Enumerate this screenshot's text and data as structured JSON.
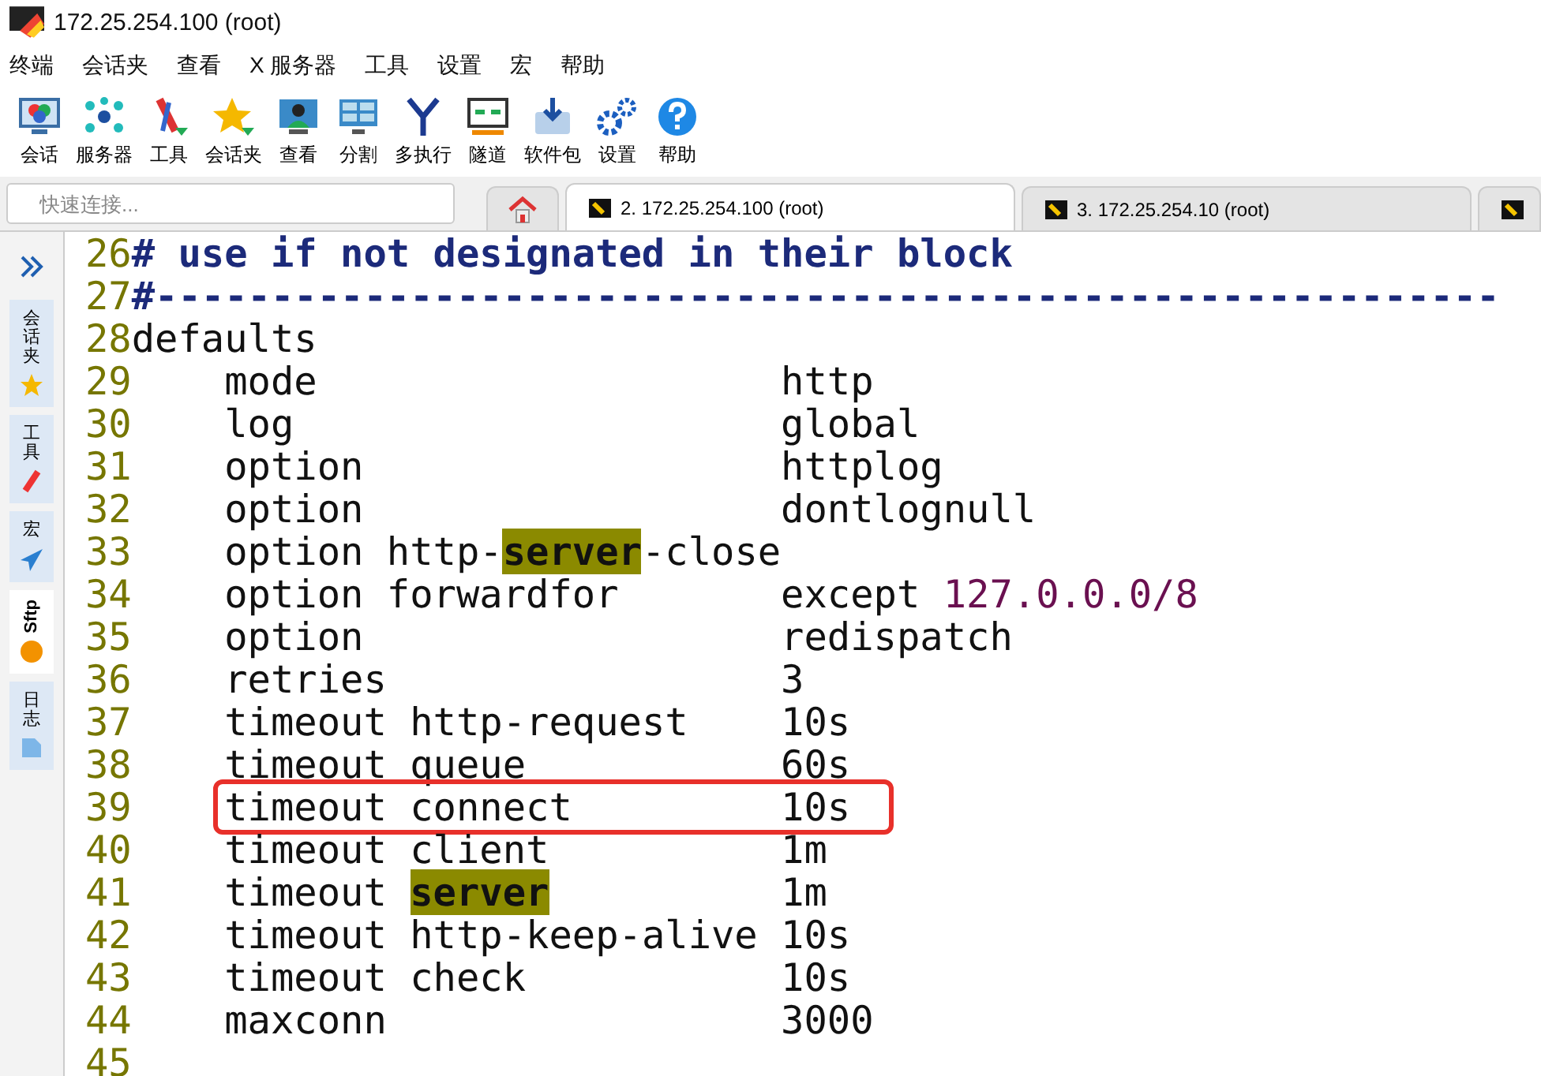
{
  "window": {
    "title": "172.25.254.100 (root)"
  },
  "menu": [
    "终端",
    "会话夹",
    "查看",
    "X 服务器",
    "工具",
    "设置",
    "宏",
    "帮助"
  ],
  "toolbar": [
    {
      "label": "会话"
    },
    {
      "label": "服务器"
    },
    {
      "label": "工具"
    },
    {
      "label": "会话夹"
    },
    {
      "label": "查看"
    },
    {
      "label": "分割"
    },
    {
      "label": "多执行"
    },
    {
      "label": "隧道"
    },
    {
      "label": "软件包"
    },
    {
      "label": "设置"
    },
    {
      "label": "帮助"
    }
  ],
  "quick_connect": {
    "placeholder": "快速连接..."
  },
  "tabs": [
    {
      "kind": "home",
      "selected": false
    },
    {
      "kind": "session",
      "label": "2. 172.25.254.100 (root)",
      "selected": true
    },
    {
      "kind": "session",
      "label": "3. 172.25.254.10 (root)",
      "selected": false
    },
    {
      "kind": "session",
      "selected": false
    }
  ],
  "sidebar": {
    "items": [
      {
        "label": "会话夹",
        "selected": false
      },
      {
        "label": "工具",
        "selected": false
      },
      {
        "label": "宏",
        "selected": false
      },
      {
        "label": "Sftp",
        "selected": true
      },
      {
        "label": "日志",
        "selected": false
      }
    ]
  },
  "editor": {
    "lines": [
      {
        "number": "26",
        "boxed": false,
        "segments": [
          {
            "kind": "comment",
            "text": "# use if not designated in their block"
          }
        ]
      },
      {
        "number": "27",
        "boxed": false,
        "segments": [
          {
            "kind": "comment",
            "text": "#----------------------------------------------------------"
          }
        ]
      },
      {
        "number": "28",
        "boxed": false,
        "segments": [
          {
            "kind": "plain",
            "text": "defaults"
          }
        ]
      },
      {
        "number": "29",
        "boxed": false,
        "segments": [
          {
            "kind": "plain",
            "text": "    mode                    http"
          }
        ]
      },
      {
        "number": "30",
        "boxed": false,
        "segments": [
          {
            "kind": "plain",
            "text": "    log                     global"
          }
        ]
      },
      {
        "number": "31",
        "boxed": false,
        "segments": [
          {
            "kind": "plain",
            "text": "    option                  httplog"
          }
        ]
      },
      {
        "number": "32",
        "boxed": false,
        "segments": [
          {
            "kind": "plain",
            "text": "    option                  dontlognull"
          }
        ]
      },
      {
        "number": "33",
        "boxed": false,
        "segments": [
          {
            "kind": "plain",
            "text": "    option http-"
          },
          {
            "kind": "highlight",
            "text": "server"
          },
          {
            "kind": "plain",
            "text": "-close"
          }
        ]
      },
      {
        "number": "34",
        "boxed": false,
        "segments": [
          {
            "kind": "plain",
            "text": "    option forwardfor       except "
          },
          {
            "kind": "number",
            "text": "127.0.0.0/8"
          }
        ]
      },
      {
        "number": "35",
        "boxed": false,
        "segments": [
          {
            "kind": "plain",
            "text": "    option                  redispatch"
          }
        ]
      },
      {
        "number": "36",
        "boxed": false,
        "segments": [
          {
            "kind": "plain",
            "text": "    retries                 3"
          }
        ]
      },
      {
        "number": "37",
        "boxed": false,
        "segments": [
          {
            "kind": "plain",
            "text": "    timeout http-request    10s"
          }
        ]
      },
      {
        "number": "38",
        "boxed": false,
        "segments": [
          {
            "kind": "plain",
            "text": "    timeout queue           60s"
          }
        ]
      },
      {
        "number": "39",
        "boxed": true,
        "segments": [
          {
            "kind": "plain",
            "text": "    timeout connect         10s"
          }
        ]
      },
      {
        "number": "40",
        "boxed": false,
        "segments": [
          {
            "kind": "plain",
            "text": "    timeout client          1m"
          }
        ]
      },
      {
        "number": "41",
        "boxed": false,
        "segments": [
          {
            "kind": "plain",
            "text": "    timeout "
          },
          {
            "kind": "highlight",
            "text": "server"
          },
          {
            "kind": "plain",
            "text": "          1m"
          }
        ]
      },
      {
        "number": "42",
        "boxed": false,
        "segments": [
          {
            "kind": "plain",
            "text": "    timeout http-keep-alive 10s"
          }
        ]
      },
      {
        "number": "43",
        "boxed": false,
        "segments": [
          {
            "kind": "plain",
            "text": "    timeout check           10s"
          }
        ]
      },
      {
        "number": "44",
        "boxed": false,
        "segments": [
          {
            "kind": "plain",
            "text": "    maxconn                 3000"
          }
        ]
      },
      {
        "number": "45"
      }
    ]
  }
}
